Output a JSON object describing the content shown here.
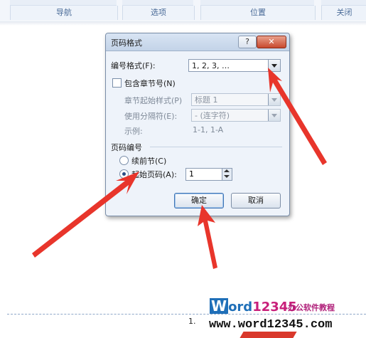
{
  "ribbon": {
    "groups": [
      "导航",
      "选项",
      "位置",
      "关闭"
    ]
  },
  "dialog": {
    "title": "页码格式",
    "help_label": "?",
    "close_label": "✕",
    "number_format": {
      "label": "编号格式(F):",
      "value": "1, 2, 3, …"
    },
    "include_chapter": {
      "label": "包含章节号(N)",
      "checked": false
    },
    "chapter_style": {
      "label": "章节起始样式(P)",
      "value": "标题 1"
    },
    "separator": {
      "label": "使用分隔符(E):",
      "value": "-  (连字符)"
    },
    "example": {
      "label": "示例:",
      "value": "1-1, 1-A"
    },
    "page_numbering": {
      "heading": "页码编号",
      "continue_label": "续前节(C)",
      "start_at_label": "起始页码(A):",
      "start_at_value": "1",
      "selected": "start_at"
    },
    "ok_label": "确定",
    "cancel_label": "取消"
  },
  "colors": {
    "arrow": "#e8352b",
    "watermark_blue": "#1f6fb8",
    "watermark_magenta": "#c81f7a"
  },
  "watermark": {
    "logo_w": "W",
    "logo_ord": "ord",
    "logo_num": "12345",
    "subtitle": "办公软件教程",
    "url": "www.word12345.com"
  },
  "document": {
    "cursor_text": "1."
  }
}
